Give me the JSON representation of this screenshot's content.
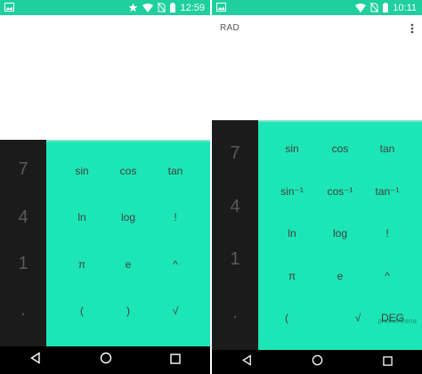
{
  "left_phone": {
    "status_time": "12:59",
    "number_keys": [
      "7",
      "4",
      "1",
      "."
    ],
    "advanced_keys": [
      [
        "sin",
        "cos",
        "tan"
      ],
      [
        "ln",
        "log",
        "!"
      ],
      [
        "π",
        "e",
        "^"
      ],
      [
        "(",
        ")",
        "√"
      ]
    ]
  },
  "right_phone": {
    "status_time": "10:11",
    "mode_label": "RAD",
    "number_keys": [
      "7",
      "4",
      "1",
      "."
    ],
    "advanced_keys": [
      [
        "sin",
        "cos",
        "tan"
      ],
      [
        "sin⁻¹",
        "cos⁻¹",
        "tan⁻¹"
      ],
      [
        "ln",
        "log",
        "!"
      ],
      [
        "π",
        "e",
        "^"
      ],
      [
        "(",
        "√",
        "DEG"
      ]
    ],
    "watermark": "phoneArena"
  },
  "colors": {
    "status_bar": "#1fcf9e",
    "advanced_pad": "#1de6b6",
    "number_column": "#1b1b1b",
    "nav_bar": "#000000"
  },
  "icons": {
    "status_left": [
      "image-icon",
      "star-icon",
      "wifi-icon",
      "no-sim-icon",
      "battery-icon"
    ],
    "status_right": [
      "image-icon",
      "wifi-icon",
      "no-sim-icon",
      "battery-icon"
    ],
    "nav": [
      "back-icon",
      "home-icon",
      "recents-icon"
    ],
    "overflow": "overflow-menu-icon"
  }
}
